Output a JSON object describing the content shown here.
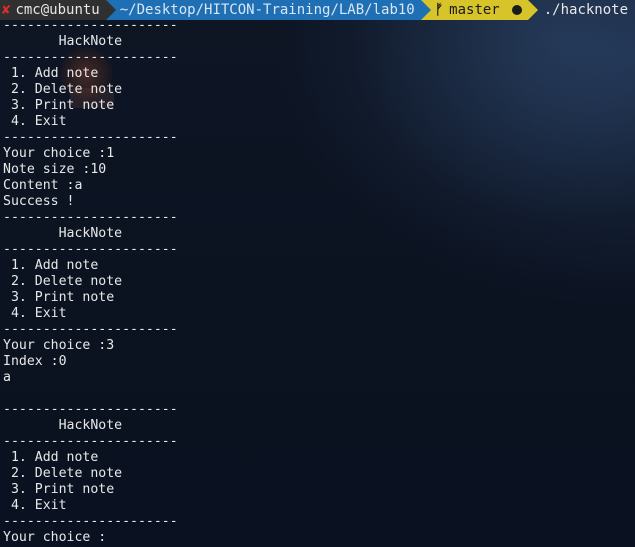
{
  "prompt": {
    "status_icon": "✘",
    "user_host": "cmc@ubuntu",
    "path": "~/Desktop/HITCON-Training/LAB/lab10",
    "branch_icon": "ᚠ",
    "branch": "master",
    "command": "./hacknote"
  },
  "colors": {
    "user_segment": "#303030",
    "path_segment": "#1f6fb5",
    "git_segment": "#d7c32a",
    "error_icon": "#e02d2d",
    "text": "#e8e8e8"
  },
  "terminal": {
    "lines": [
      "----------------------",
      "       HackNote",
      "----------------------",
      " 1. Add note",
      " 2. Delete note",
      " 3. Print note",
      " 4. Exit",
      "----------------------",
      "Your choice :1",
      "Note size :10",
      "Content :a",
      "Success !",
      "----------------------",
      "       HackNote",
      "----------------------",
      " 1. Add note",
      " 2. Delete note",
      " 3. Print note",
      " 4. Exit",
      "----------------------",
      "Your choice :3",
      "Index :0",
      "a",
      "",
      "----------------------",
      "       HackNote",
      "----------------------",
      " 1. Add note",
      " 2. Delete note",
      " 3. Print note",
      " 4. Exit",
      "----------------------",
      "Your choice :"
    ]
  }
}
